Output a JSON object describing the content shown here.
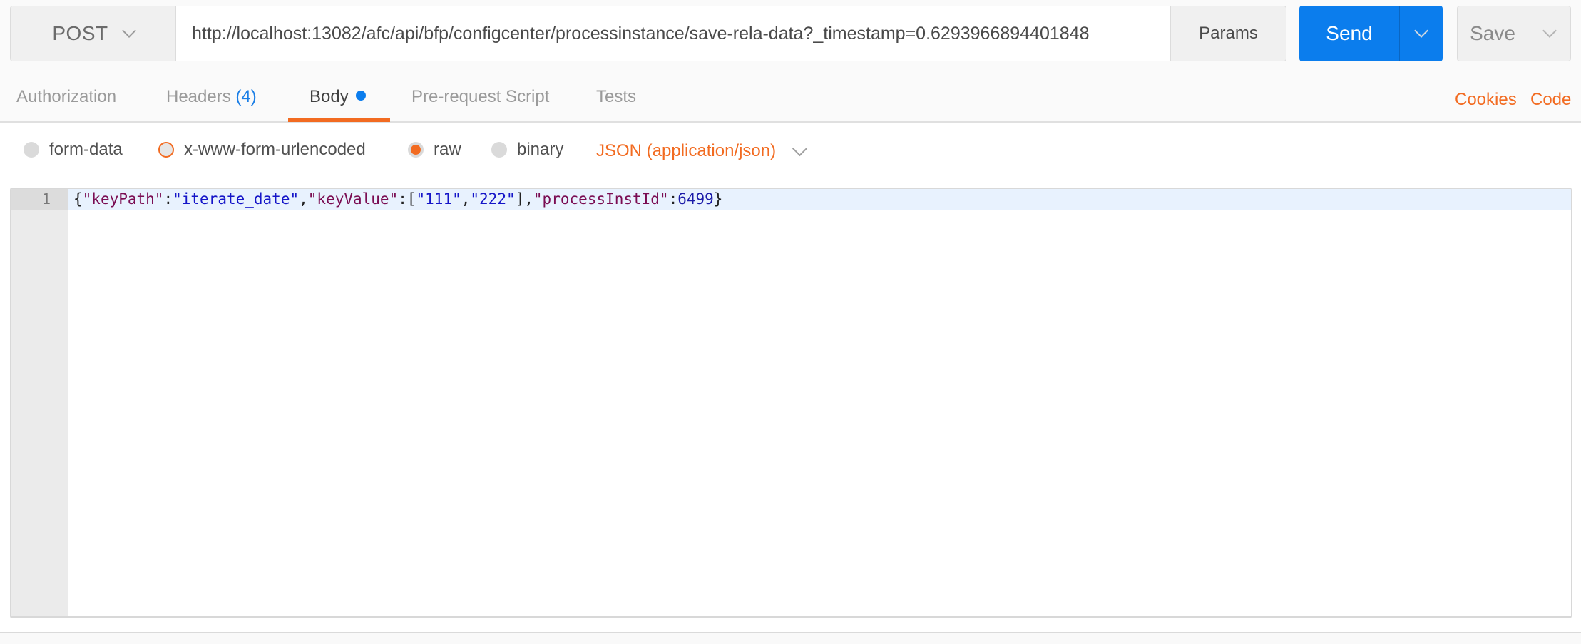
{
  "request": {
    "method": "POST",
    "url": "http://localhost:13082/afc/api/bfp/configcenter/processinstance/save-rela-data?_timestamp=0.6293966894401848",
    "params_label": "Params",
    "send_label": "Send",
    "save_label": "Save"
  },
  "tabs": {
    "authorization": "Authorization",
    "headers": "Headers",
    "headers_count": "(4)",
    "body": "Body",
    "pre_request": "Pre-request Script",
    "tests": "Tests",
    "active": "Body",
    "cookies_link": "Cookies",
    "code_link": "Code"
  },
  "body_modes": {
    "options": [
      "form-data",
      "x-www-form-urlencoded",
      "raw",
      "binary"
    ],
    "selected": "raw",
    "content_type": "JSON (application/json)"
  },
  "editor": {
    "line_number": "1",
    "tokens": {
      "t1": "{",
      "t2": "\"keyPath\"",
      "t3": ":",
      "t4": "\"iterate_date\"",
      "t5": ",",
      "t6": "\"keyValue\"",
      "t7": ":[",
      "t8": "\"111\"",
      "t9": ",",
      "t10": "\"222\"",
      "t11": "],",
      "t12": "\"processInstId\"",
      "t13": ":",
      "t14": "6499",
      "t15": "}"
    }
  },
  "colors": {
    "accent_orange": "#f26b21",
    "send_blue": "#0b7ded",
    "json_key": "#7a0c52",
    "json_string": "#1515c8"
  }
}
